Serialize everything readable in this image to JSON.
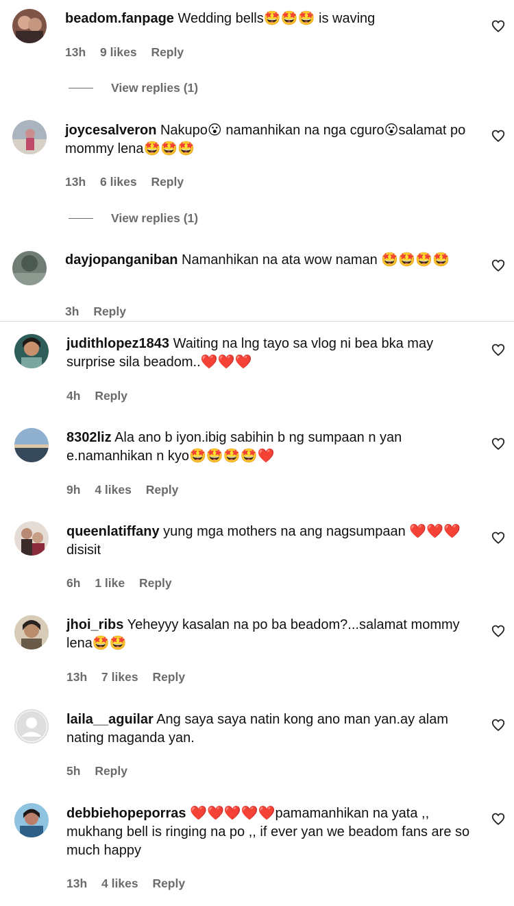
{
  "comments": [
    {
      "username": "beadom.fanpage",
      "text": "Wedding bells🤩🤩🤩 is waving",
      "time": "13h",
      "likes": "9 likes",
      "reply": "Reply",
      "view_replies": "View replies (1)",
      "avatar_color": "#8b5a4a"
    },
    {
      "username": "joycesalveron",
      "text": "Nakupo😮 namanhikan na nga cguro😮salamat po mommy lena🤩🤩🤩",
      "time": "13h",
      "likes": "6 likes",
      "reply": "Reply",
      "view_replies": "View replies (1)",
      "avatar_color": "#9aa7b5"
    },
    {
      "username": "dayjopanganiban",
      "text": "Namanhikan na ata wow naman 🤩🤩🤩🤩",
      "time": "3h",
      "likes": "",
      "reply": "Reply",
      "avatar_color": "#5c6b62"
    },
    {
      "username": "judithlopez1843",
      "text": "Waiting na lng tayo sa vlog ni bea bka may surprise sila beadom..❤️❤️❤️",
      "time": "4h",
      "likes": "",
      "reply": "Reply",
      "avatar_color": "#3f6d6a"
    },
    {
      "username": "8302liz",
      "text": "Ala ano b iyon.ibig sabihin b ng sumpaan n yan e.namanhikan n kyo🤩🤩🤩🤩❤️",
      "time": "9h",
      "likes": "4 likes",
      "reply": "Reply",
      "avatar_color": "#6d8aa8"
    },
    {
      "username": "queenlatiffany",
      "text": "yung mga mothers na ang nagsumpaan ❤️❤️❤️ disisit",
      "time": "6h",
      "likes": "1 like",
      "reply": "Reply",
      "avatar_color": "#6a3e3e"
    },
    {
      "username": "jhoi_ribs",
      "text": "Yeheyyy kasalan na po ba beadom?...salamat mommy lena🤩🤩",
      "time": "13h",
      "likes": "7 likes",
      "reply": "Reply",
      "avatar_color": "#a58a6a"
    },
    {
      "username": "laila__aguilar",
      "text": "Ang saya saya natin kong ano man yan.ay alam nating maganda yan.",
      "time": "5h",
      "likes": "",
      "reply": "Reply",
      "avatar_color": "#d9d9d9"
    },
    {
      "username": "debbiehopeporras",
      "text": "❤️❤️❤️❤️❤️pamamanhikan na yata ,, mukhang bell is ringing na po ,, if ever yan we beadom fans are so much happy",
      "time": "13h",
      "likes": "4 likes",
      "reply": "Reply",
      "avatar_color": "#3e7fa6"
    }
  ],
  "icons": {
    "like": "heart-outline-icon",
    "avatar_placeholder": "person-silhouette-icon"
  },
  "colors": {
    "meta": "#6b6b6b",
    "text": "#111111",
    "divider": "#d8d8d8"
  }
}
